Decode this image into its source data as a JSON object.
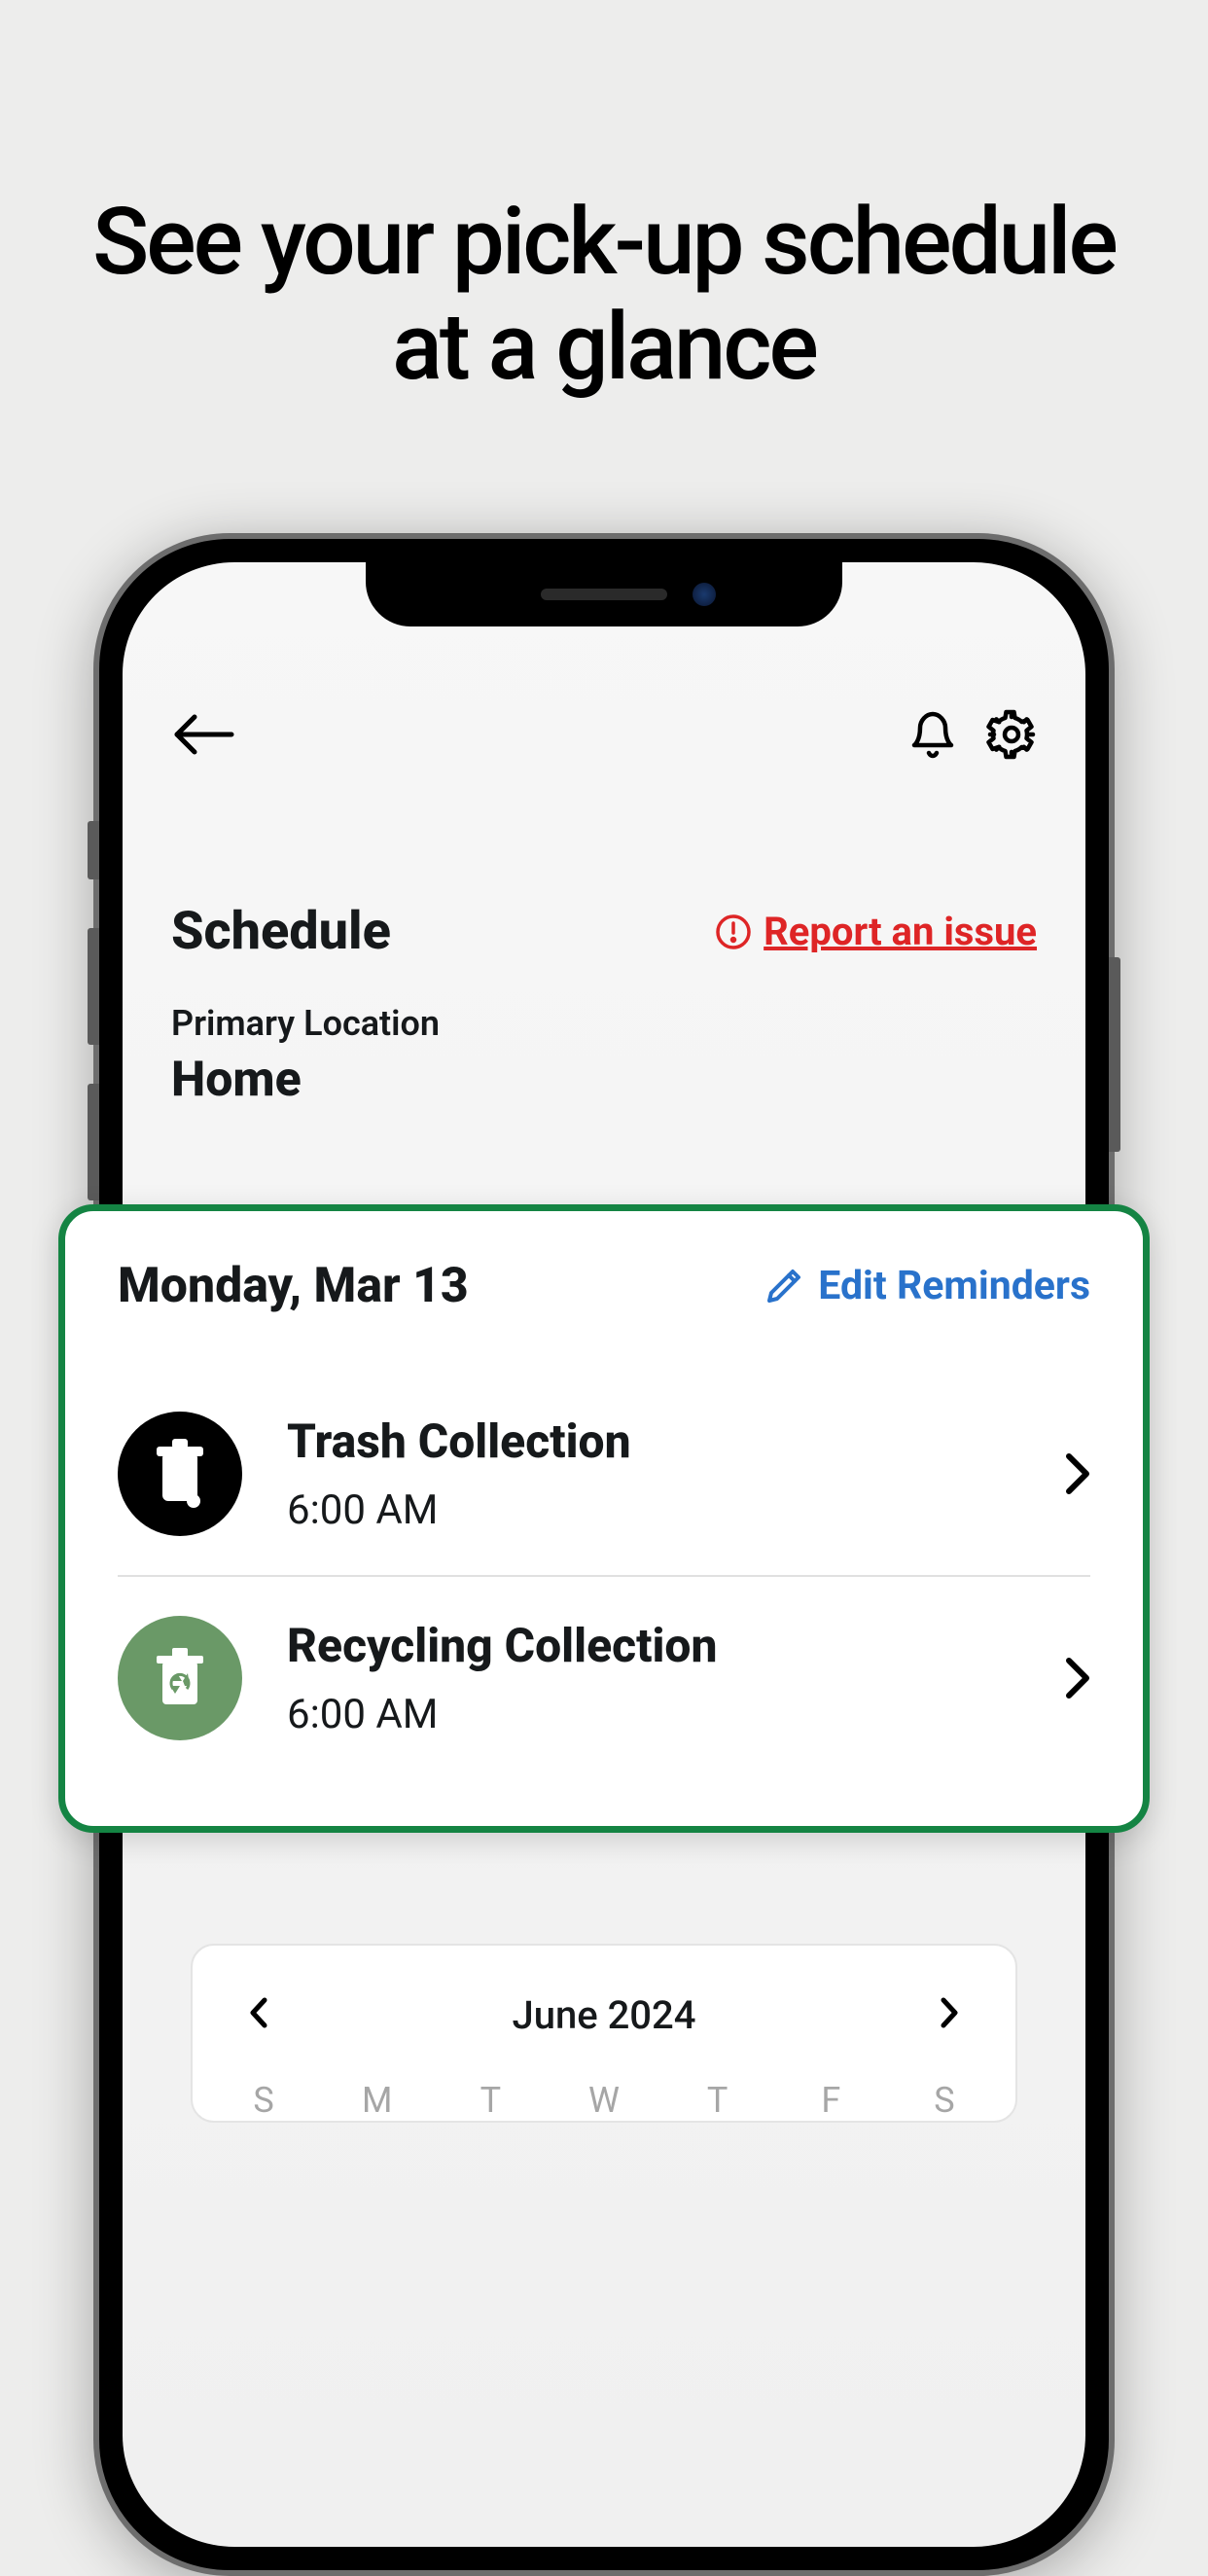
{
  "headline": "See your pick-up schedule at a glance",
  "screen": {
    "title": "Schedule",
    "report_issue": "Report an issue",
    "location_label": "Primary Location",
    "location_value": "Home"
  },
  "card": {
    "date": "Monday, Mar 13",
    "edit_reminders": "Edit Reminders",
    "items": [
      {
        "title": "Trash Collection",
        "time": "6:00 AM"
      },
      {
        "title": "Recycling Collection",
        "time": "6:00 AM"
      }
    ]
  },
  "calendar": {
    "month": "June 2024",
    "days": [
      "S",
      "M",
      "T",
      "W",
      "T",
      "F",
      "S"
    ]
  }
}
